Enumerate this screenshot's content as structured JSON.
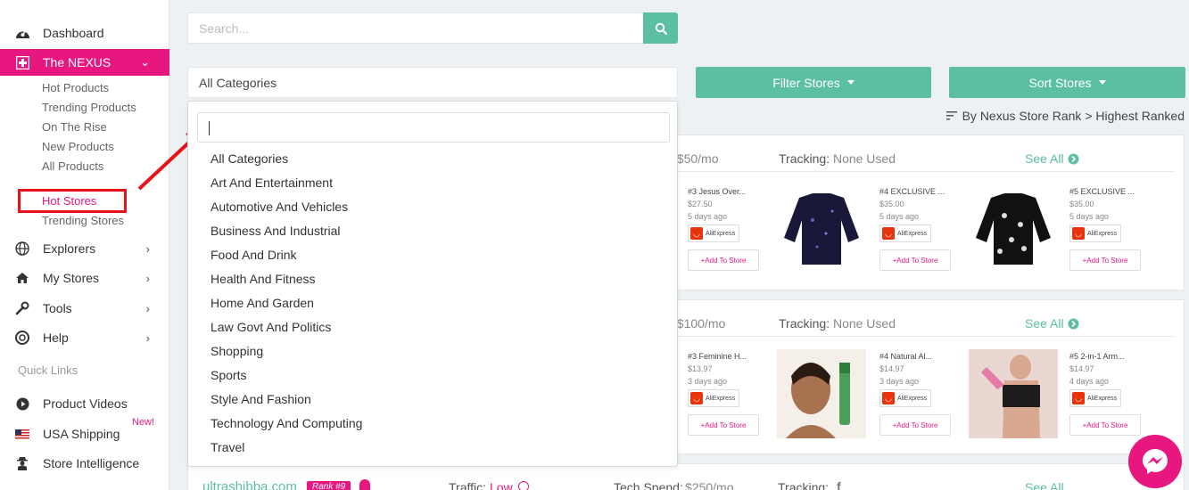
{
  "sidebar": {
    "nav": [
      {
        "label": "Dashboard",
        "icon": "dashboard-icon"
      },
      {
        "label": "The NEXUS",
        "icon": "nexus-icon"
      },
      {
        "label": "Explorers",
        "icon": "globe-icon"
      },
      {
        "label": "My Stores",
        "icon": "home-icon"
      },
      {
        "label": "Tools",
        "icon": "wrench-icon"
      },
      {
        "label": "Help",
        "icon": "lifebuoy-icon"
      }
    ],
    "nexus_sub": [
      "Hot Products",
      "Trending Products",
      "On The Rise",
      "New Products",
      "All Products"
    ],
    "stores_sub": [
      "Hot Stores",
      "Trending Stores"
    ],
    "quick_links_label": "Quick Links",
    "quick_links": [
      {
        "label": "Product Videos",
        "icon": "play-icon"
      },
      {
        "label": "USA Shipping",
        "icon": "us-flag-icon",
        "badge": "New!"
      },
      {
        "label": "Store Intelligence",
        "icon": "spy-icon"
      }
    ]
  },
  "search": {
    "placeholder": "Search..."
  },
  "category_select": {
    "selected": "All Categories"
  },
  "filter_button": "Filter Stores",
  "sort_button": "Sort Stores",
  "sort_line": "By Nexus Store Rank > Highest Ranked",
  "dropdown": {
    "options": [
      "All Categories",
      "Art And Entertainment",
      "Automotive And Vehicles",
      "Business And Industrial",
      "Food And Drink",
      "Health And Fitness",
      "Home And Garden",
      "Law Govt And Politics",
      "Shopping",
      "Sports",
      "Style And Fashion",
      "Technology And Computing",
      "Travel"
    ]
  },
  "cards": [
    {
      "spend": ": $50/mo",
      "tracking_label": "Tracking:",
      "tracking_value": "None Used",
      "see_all": "See All",
      "products": [
        {
          "name": "#3 Jesus Over...",
          "price": "$27.50",
          "date": "5 days ago"
        },
        {
          "name": "#4 EXCLUSIVE ...",
          "price": "$35.00",
          "date": "5 days ago"
        },
        {
          "name": "#5 EXCLUSIVE ...",
          "price": "$35.00",
          "date": "5 days ago"
        }
      ]
    },
    {
      "spend": ": $100/mo",
      "tracking_label": "Tracking:",
      "tracking_value": "None Used",
      "see_all": "See All",
      "products": [
        {
          "name": "#3 Feminine H...",
          "price": "$13.97",
          "date": "3 days ago"
        },
        {
          "name": "#4 Natural Al...",
          "price": "$14.97",
          "date": "3 days ago"
        },
        {
          "name": "#5 2-in-1 Arm...",
          "price": "$14.97",
          "date": "4 days ago"
        }
      ]
    }
  ],
  "ae_label": "AliExpress",
  "add_to_store": "Add To Store",
  "bottom_row": {
    "store": "ultrashibba.com",
    "rank": "Rank #9",
    "traffic_label": "Traffic:",
    "traffic_value": "Low",
    "tech_label": "Tech Spend:",
    "tech_value": "$250/mo",
    "tracking_label": "Tracking:",
    "see_all": "See All"
  },
  "colors": {
    "accent": "#e8167f",
    "green": "#5cbfa3",
    "highlight": "#e8131a"
  }
}
